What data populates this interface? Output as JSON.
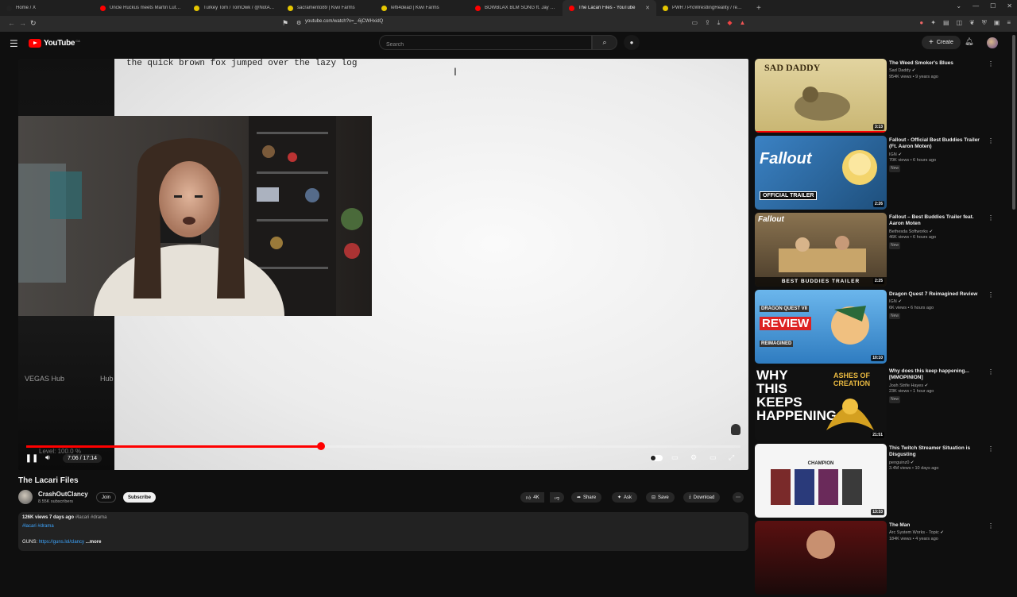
{
  "browser": {
    "tabs": [
      {
        "title": "Home / X",
        "color": "#222222",
        "active": false
      },
      {
        "title": "Uncle Ruckus meets Martin Luther K",
        "color": "#ff0000",
        "active": false
      },
      {
        "title": "Turkey Tom / TomOwk / @NotATurk",
        "color": "#e5c600",
        "active": false
      },
      {
        "title": "sacramento89 | Kiwi Farms",
        "color": "#e5c600",
        "active": false
      },
      {
        "title": "lefti4dead | Kiwi Farms",
        "color": "#e5c600",
        "active": false
      },
      {
        "title": "BOWBLAX BLM SONG ft. Jay Z, Emin",
        "color": "#ff0000",
        "active": false
      },
      {
        "title": "The Lacari Files - YouTube",
        "color": "#ff0000",
        "active": true
      },
      {
        "title": "PWR / ProWrestlingReality / realpers",
        "color": "#e5c600",
        "active": false
      }
    ],
    "url": "youtube.com/watch?v=_-6jCWHxidQ"
  },
  "header": {
    "logo_text": "YouTube",
    "logo_country": "CA",
    "search_placeholder": "Search",
    "create_label": "Create"
  },
  "player": {
    "typed_text": "the quick brown fox jumped over the lazy log",
    "overlay_left": "VEGAS Hub",
    "overlay_right": "Hub",
    "level_text": "Level: 100.0 %",
    "time": "7:06 / 17:14",
    "progress": 0.4122,
    "buffered": 0.4344
  },
  "video": {
    "title": "The Lacari Files",
    "channel": "CrashOutClancy",
    "subscribers": "8.55K subscribers",
    "join_label": "Join",
    "subscribe_label": "Subscribe",
    "likes": "4K",
    "share_label": "Share",
    "ask_label": "Ask",
    "save_label": "Save",
    "download_label": "Download",
    "meta": "126K views  7 days ago",
    "meta_tags": "#lacari #drama",
    "desc_tags": "#lacari #drama",
    "guns_label": "GUNS:",
    "guns_link": "https://guns.lol/clancy",
    "more_label": "...more"
  },
  "recommendations": [
    {
      "title": "The Weed Smoker's Blues",
      "channel": "Sad Daddy",
      "views": "954K views • 9 years ago",
      "duration": "3:13",
      "new": false,
      "thumb_text": "SAD DADDY",
      "thumb_bg": "#d8c68a",
      "watched": 1.0
    },
    {
      "title": "Fallout - Official Best Buddies Trailer (Ft. Aaron Moten)",
      "channel": "IGN",
      "views": "70K views • 6 hours ago",
      "duration": "2:26",
      "new": true,
      "thumb_text": "Fallout",
      "thumb_sub": "OFFICIAL TRAILER",
      "thumb_bg": "#2e6fa7",
      "watched": 0
    },
    {
      "title": "Fallout – Best Buddies Trailer feat. Aaron Moten",
      "channel": "Bethesda Softworks",
      "views": "46K views • 6 hours ago",
      "duration": "2:25",
      "new": true,
      "thumb_text": "Fallout",
      "thumb_sub": "BEST BUDDIES TRAILER",
      "thumb_bg": "#6d5a3b",
      "watched": 0
    },
    {
      "title": "Dragon Quest 7 Reimagined Review",
      "channel": "IGN",
      "views": "6K views • 6 hours ago",
      "duration": "10:10",
      "new": true,
      "thumb_text": "REVIEW",
      "thumb_sub": "DRAGON QUEST VII",
      "thumb_sub2": "REIMAGINED",
      "thumb_bg": "#3f8fd1",
      "watched": 0
    },
    {
      "title": "Why does this keep happening... [MMOPINION]",
      "channel": "Josh Strife Hayes",
      "views": "23K views • 1 hour ago",
      "duration": "21:51",
      "new": true,
      "thumb_text": "WHY THIS KEEPS HAPPENING",
      "thumb_sub": "ASHES OF CREATION",
      "thumb_bg": "#141414",
      "watched": 0
    },
    {
      "title": "This Twitch Streamer Situation is Disgusting",
      "channel": "penguinz0",
      "views": "3.4M views • 10 days ago",
      "duration": "13:33",
      "new": false,
      "thumb_text": "CHAMPION",
      "thumb_bg": "#f0f0f0",
      "watched": 0
    },
    {
      "title": "The Man",
      "channel": "Arc System Works - Topic",
      "views": "184K views • 4 years ago",
      "duration": "",
      "new": false,
      "thumb_text": "",
      "thumb_bg": "#8a1a1a",
      "watched": 0
    }
  ],
  "colors": {
    "accent": "#ff0000",
    "link": "#3ea6ff",
    "bg": "#0f0f0f"
  }
}
